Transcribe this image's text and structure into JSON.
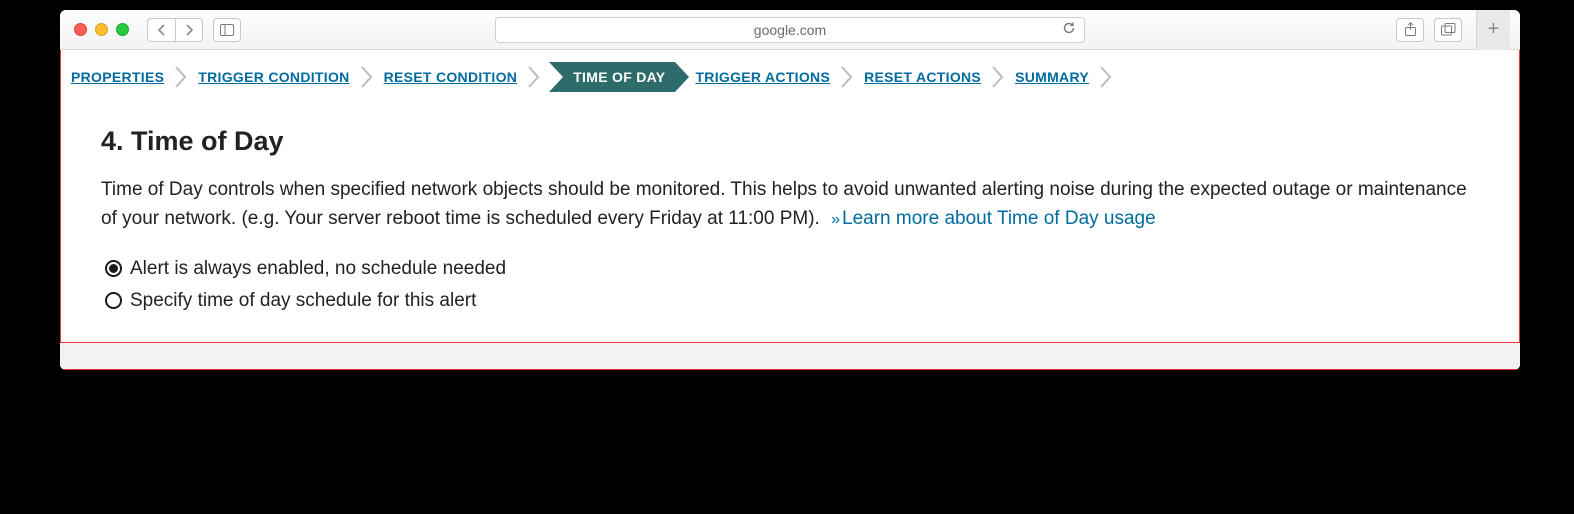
{
  "browser": {
    "url": "google.com"
  },
  "breadcrumb": {
    "items": [
      {
        "label": "PROPERTIES"
      },
      {
        "label": "TRIGGER CONDITION"
      },
      {
        "label": "RESET CONDITION"
      },
      {
        "label": "TIME OF DAY",
        "current": true
      },
      {
        "label": "TRIGGER ACTIONS"
      },
      {
        "label": "RESET ACTIONS"
      },
      {
        "label": "SUMMARY"
      }
    ]
  },
  "main": {
    "heading": "4. Time of Day",
    "description": "Time of Day controls when specified network objects should be monitored. This helps to avoid unwanted alerting noise during the expected outage or maintenance of your network. (e.g. Your server reboot time is scheduled every Friday at 11:00 PM).",
    "learn_prefix": "»",
    "learn_more": "Learn more about Time of Day usage"
  },
  "options": {
    "opt1": {
      "label": "Alert is always enabled, no schedule needed",
      "checked": true
    },
    "opt2": {
      "label": "Specify time of day schedule for this alert",
      "checked": false
    }
  }
}
